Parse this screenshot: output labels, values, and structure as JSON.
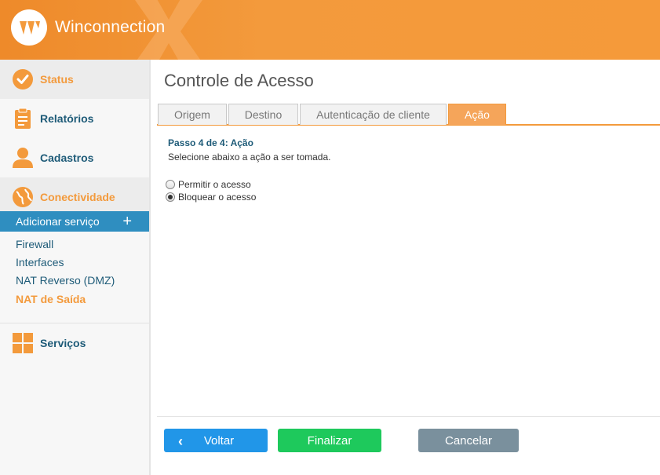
{
  "header": {
    "app_name": "Winconnection"
  },
  "sidebar": {
    "items": [
      {
        "label": "Status",
        "icon": "check-circle-icon"
      },
      {
        "label": "Relatórios",
        "icon": "clipboard-icon"
      },
      {
        "label": "Cadastros",
        "icon": "user-icon"
      },
      {
        "label": "Conectividade",
        "icon": "globe-icon"
      },
      {
        "label": "Serviços",
        "icon": "grid-icon"
      }
    ],
    "add_service": "Adicionar serviço",
    "sub_items": [
      "Firewall",
      "Interfaces",
      "NAT Reverso (DMZ)",
      "NAT de Saída"
    ],
    "active_sub_item": "NAT de Saída"
  },
  "main": {
    "title": "Controle de Acesso",
    "tabs": [
      "Origem",
      "Destino",
      "Autenticação de cliente",
      "Ação"
    ],
    "active_tab": "Ação",
    "step_title": "Passo 4 de 4: Ação",
    "step_description": "Selecione abaixo a ação a ser tomada.",
    "options": [
      {
        "label": "Permitir o acesso",
        "checked": false
      },
      {
        "label": "Bloquear o acesso",
        "checked": true
      }
    ]
  },
  "buttons": {
    "back": "Voltar",
    "finish": "Finalizar",
    "cancel": "Cancelar"
  },
  "colors": {
    "brand_orange": "#f39a3c",
    "nav_text": "#1e5b78",
    "back": "#2196e8",
    "finish": "#1ec95c",
    "cancel": "#7a909d"
  }
}
